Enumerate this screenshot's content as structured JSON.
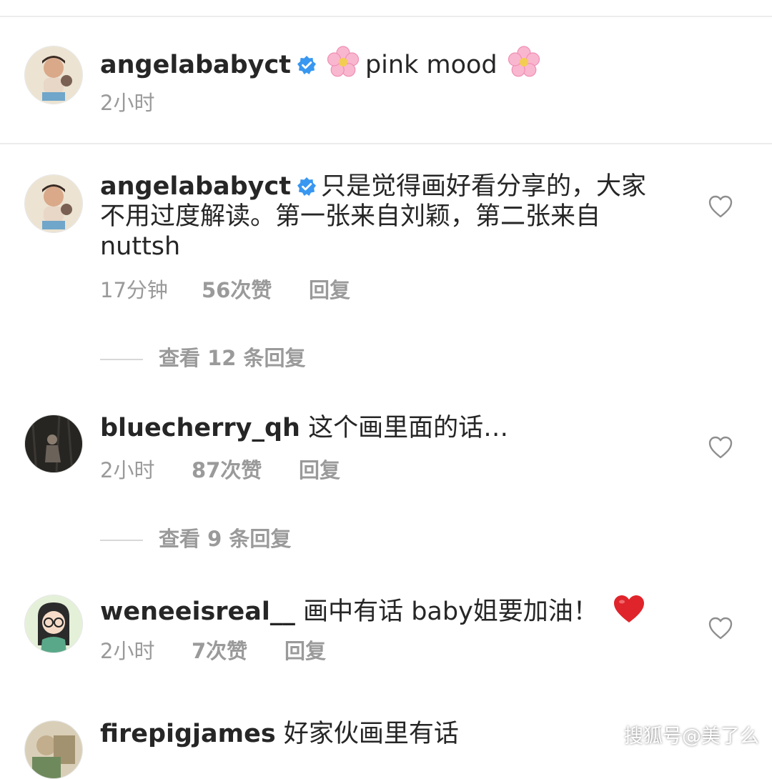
{
  "caption": {
    "username": "angelababyct",
    "text": "pink mood",
    "time": "2小时"
  },
  "comments": [
    {
      "username": "angelababyct",
      "text_line1": "只是觉得画好看分享的，大家",
      "text_line2": "不用过度解读。第一张来自刘颖，第二张来自",
      "text_line3": "nuttsh",
      "time": "17分钟",
      "likes": "56次赞",
      "reply": "回复",
      "view_replies": "查看 12 条回复"
    },
    {
      "username": "bluecherry_qh",
      "text": "这个画里面的话…",
      "time": "2小时",
      "likes": "87次赞",
      "reply": "回复",
      "view_replies": "查看 9 条回复"
    },
    {
      "username": "weneeisreal__",
      "text": "画中有话 baby姐要加油！",
      "time": "2小时",
      "likes": "7次赞",
      "reply": "回复"
    },
    {
      "username": "firepigjames",
      "text": "好家伙画里有话"
    }
  ],
  "watermark": "搜狐号@美了么",
  "icons": {
    "verified": "verified-badge-icon",
    "flower": "cherry-blossom-icon",
    "heart": "heart-outline-icon",
    "red_heart": "red-heart-icon"
  },
  "colors": {
    "verified_blue": "#3897f0",
    "muted_text": "#9a9a9a",
    "red_heart": "#e0242b"
  }
}
